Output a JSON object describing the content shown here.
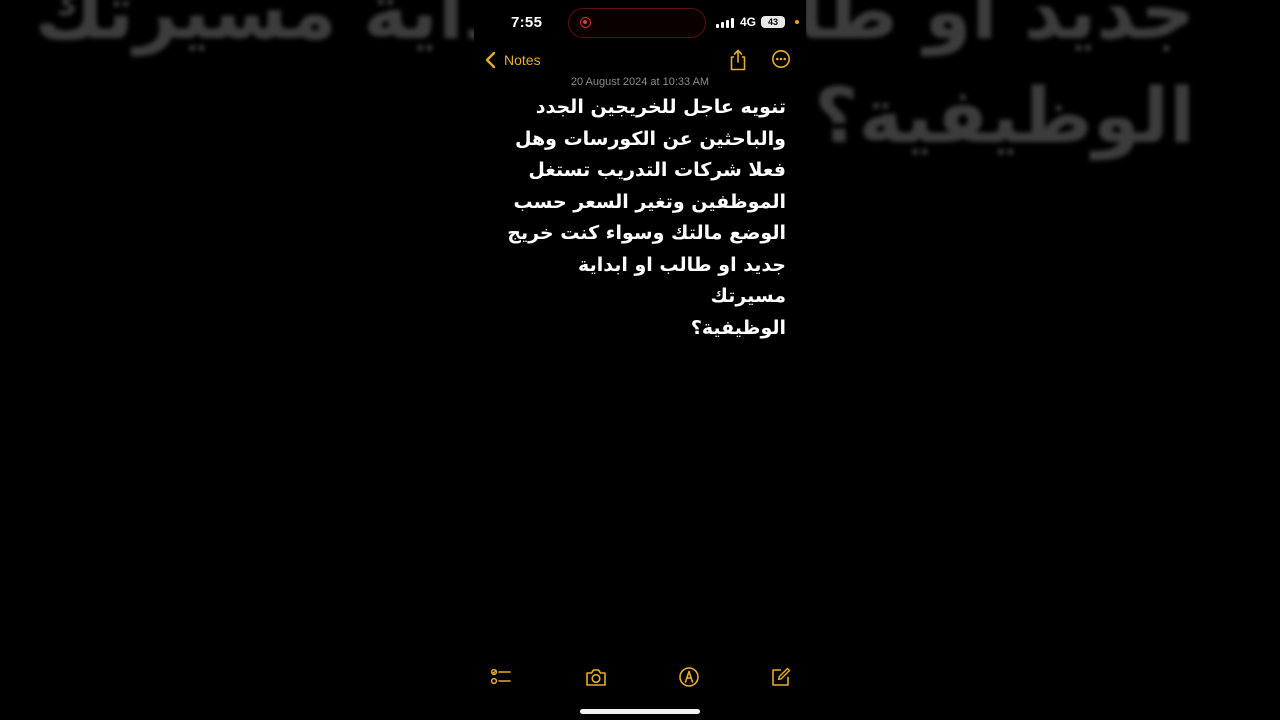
{
  "background_echo": {
    "line1": "جديد او طالب او ابداية مسيرتك",
    "line2": "الوظيفية؟"
  },
  "status_bar": {
    "time": "7:55",
    "network": "4G",
    "battery": "43"
  },
  "nav": {
    "back_label": "Notes"
  },
  "note": {
    "date": "20 August 2024 at 10:33 AM",
    "body": "تنويه عاجل للخريجين الجدد\nوالباحثين عن الكورسات وهل\nفعلا شركات التدريب تستغل\nالموظفين وتغير السعر حسب\nالوضع مالتك وسواء كنت خريج\nجديد او طالب او ابداية مسيرتك\nالوظيفية؟"
  },
  "toolbar": {
    "icons": [
      "checklist-icon",
      "camera-icon",
      "markup-icon",
      "compose-icon"
    ]
  },
  "colors": {
    "accent": "#e5ac2f",
    "background": "#000000",
    "text": "#ffffff",
    "secondary_text": "#8a8a8e"
  }
}
